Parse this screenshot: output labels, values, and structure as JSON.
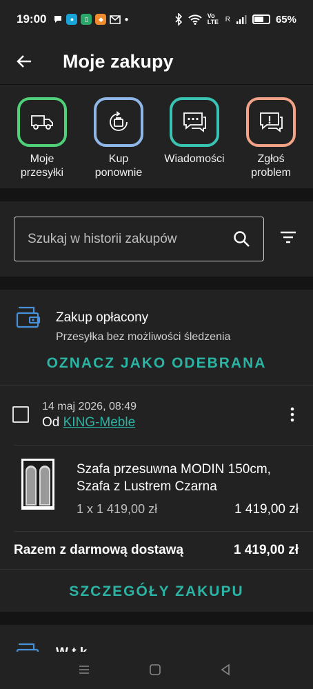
{
  "status_bar": {
    "time": "19:00",
    "network": "Vo LTE",
    "signal": "R",
    "battery": "65%"
  },
  "header": {
    "title": "Moje zakupy"
  },
  "shortcuts": [
    {
      "label_1": "Moje",
      "label_2": "przesyłki",
      "color": "#4fd17a",
      "icon": "truck-icon"
    },
    {
      "label_1": "Kup",
      "label_2": "ponownie",
      "color": "#8fb8e8",
      "icon": "rebuy-icon"
    },
    {
      "label_1": "Wiadomości",
      "label_2": "",
      "color": "#39c3b3",
      "icon": "chat-icon"
    },
    {
      "label_1": "Zgłoś",
      "label_2": "problem",
      "color": "#f2a286",
      "icon": "report-problem-icon"
    }
  ],
  "search": {
    "placeholder": "Szukaj w historii zakupów"
  },
  "purchase": {
    "status_title": "Zakup opłacony",
    "status_subtitle": "Przesyłka bez możliwości śledzenia",
    "mark_received": "OZNACZ JAKO ODEBRANA",
    "date": "14 maj 2026, 08:49",
    "seller_prefix": "Od ",
    "seller_name": "KING-Meble",
    "product_name": "Szafa przesuwna MODIN 150cm, Szafa z Lustrem Czarna",
    "quantity_price": "1 x 1 419,00 zł",
    "line_total": "1 419,00 zł",
    "total_label": "Razem z darmową dostawą",
    "total_value": "1 419,00 zł",
    "details": "SZCZEGÓŁY ZAKUPU"
  },
  "next_purchase": {
    "partial_title": "W  t  k"
  },
  "colors": {
    "accent": "#2bb3a3",
    "background": "#141414",
    "card": "#222222"
  }
}
